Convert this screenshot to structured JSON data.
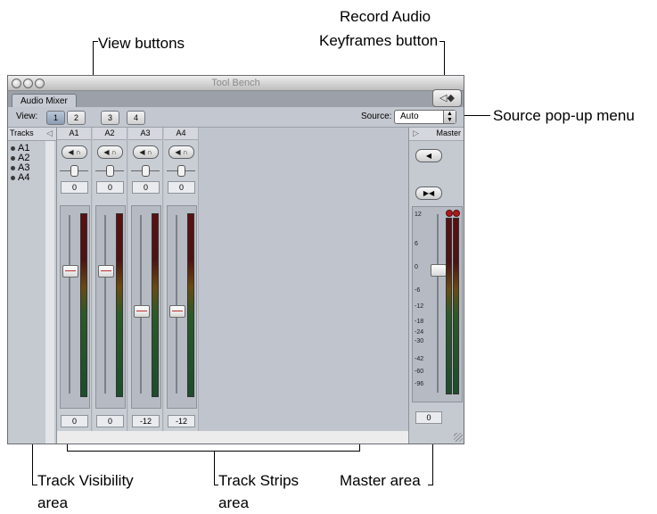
{
  "callouts": {
    "view_buttons": "View buttons",
    "record_audio_line1": "Record Audio",
    "record_audio_line2": "Keyframes button",
    "source_popup": "Source pop-up menu",
    "track_visibility_line1": "Track Visibility",
    "track_visibility_line2": "area",
    "track_strips_line1": "Track Strips",
    "track_strips_line2": "area",
    "master_area": "Master area"
  },
  "window": {
    "title": "Tool Bench",
    "tab_label": "Audio Mixer",
    "record_icon": "speaker-keyframe-icon",
    "record_glyph": "◁◆"
  },
  "toolbar": {
    "view_label": "View:",
    "view_buttons": [
      "1",
      "2",
      "3",
      "4"
    ],
    "active_view": "1",
    "source_label": "Source:",
    "source_value": "Auto"
  },
  "tracks_panel": {
    "header": "Tracks",
    "collapse_glyph": "◁",
    "items": [
      "A1",
      "A2",
      "A3",
      "A4"
    ]
  },
  "strips": [
    {
      "name": "A1",
      "pan": "0",
      "level": "0",
      "fader_db": 0,
      "meter_marker": ""
    },
    {
      "name": "A2",
      "pan": "0",
      "level": "0",
      "fader_db": 0,
      "meter_marker": ""
    },
    {
      "name": "A3",
      "pan": "0",
      "level": "-12",
      "fader_db": -12,
      "meter_marker": "-"
    },
    {
      "name": "A4",
      "pan": "0",
      "level": "-12",
      "fader_db": -12,
      "meter_marker": "-"
    }
  ],
  "strip_buttons": {
    "mute_glyph": "◀",
    "solo_glyph": "∩"
  },
  "master": {
    "header": "Master",
    "expand_glyph": "▷",
    "mute_glyph": "◀",
    "downmix_glyph": "▶◀",
    "scale": [
      "12",
      "6",
      "0",
      "-6",
      "-12",
      "-18",
      "-24",
      "-30",
      "-42",
      "-60",
      "-96"
    ],
    "level": "0",
    "fader_db": 0
  },
  "colors": {
    "window_bg": "#bfc3cc",
    "clip_led": "#b01818",
    "fader_line": "#c03030"
  }
}
